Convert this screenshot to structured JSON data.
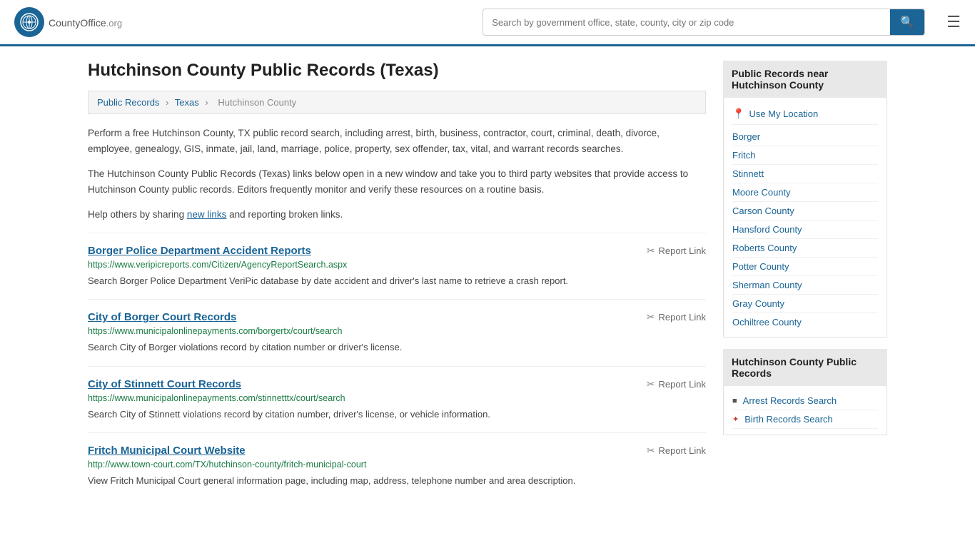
{
  "header": {
    "logo_text": "CountyOffice",
    "logo_suffix": ".org",
    "search_placeholder": "Search by government office, state, county, city or zip code"
  },
  "page": {
    "title": "Hutchinson County Public Records (Texas)",
    "breadcrumb": {
      "items": [
        "Public Records",
        "Texas",
        "Hutchinson County"
      ]
    },
    "description1": "Perform a free Hutchinson County, TX public record search, including arrest, birth, business, contractor, court, criminal, death, divorce, employee, genealogy, GIS, inmate, jail, land, marriage, police, property, sex offender, tax, vital, and warrant records searches.",
    "description2": "The Hutchinson County Public Records (Texas) links below open in a new window and take you to third party websites that provide access to Hutchinson County public records. Editors frequently monitor and verify these resources on a routine basis.",
    "description3_pre": "Help others by sharing ",
    "new_links_text": "new links",
    "description3_post": " and reporting broken links."
  },
  "results": [
    {
      "title": "Borger Police Department Accident Reports",
      "url": "https://www.veripicreports.com/Citizen/AgencyReportSearch.aspx",
      "description": "Search Borger Police Department VeriPic database by date accident and driver's last name to retrieve a crash report.",
      "report_label": "Report Link"
    },
    {
      "title": "City of Borger Court Records",
      "url": "https://www.municipalonlinepayments.com/borgertx/court/search",
      "description": "Search City of Borger violations record by citation number or driver's license.",
      "report_label": "Report Link"
    },
    {
      "title": "City of Stinnett Court Records",
      "url": "https://www.municipalonlinepayments.com/stinnetttx/court/search",
      "description": "Search City of Stinnett violations record by citation number, driver's license, or vehicle information.",
      "report_label": "Report Link"
    },
    {
      "title": "Fritch Municipal Court Website",
      "url": "http://www.town-court.com/TX/hutchinson-county/fritch-municipal-court",
      "description": "View Fritch Municipal Court general information page, including map, address, telephone number and area description.",
      "report_label": "Report Link"
    }
  ],
  "sidebar": {
    "nearby_header": "Public Records near Hutchinson County",
    "use_my_location": "Use My Location",
    "nearby_links": [
      "Borger",
      "Fritch",
      "Stinnett",
      "Moore County",
      "Carson County",
      "Hansford County",
      "Roberts County",
      "Potter County",
      "Sherman County",
      "Gray County",
      "Ochiltree County"
    ],
    "records_header": "Hutchinson County Public Records",
    "record_links": [
      {
        "label": "Arrest Records Search",
        "type": "square"
      },
      {
        "label": "Birth Records Search",
        "type": "special"
      }
    ]
  }
}
